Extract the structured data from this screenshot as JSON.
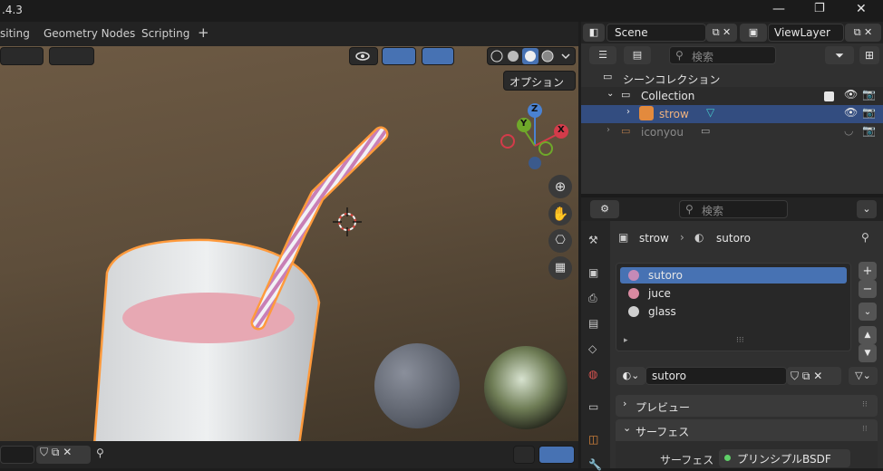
{
  "title": {
    "version": ".4.3",
    "min": "—",
    "max": "❐",
    "close": "✕"
  },
  "workspace_tabs": [
    "siting",
    "Geometry Nodes",
    "Scripting",
    "+"
  ],
  "viewport": {
    "options_label": "オプション",
    "gizmo": {
      "z": "Z",
      "y": "Y",
      "x": "X"
    }
  },
  "scene": {
    "label": "Scene",
    "viewlayer": "ViewLayer"
  },
  "outliner": {
    "search_placeholder": "検索",
    "root": "シーンコレクション",
    "collection": "Collection",
    "items": [
      {
        "name": "strow",
        "selected": true
      },
      {
        "name": "iconyou",
        "selected": false
      }
    ]
  },
  "properties": {
    "search_placeholder": "検索",
    "breadcrumb": {
      "object": "strow",
      "material": "sutoro"
    },
    "slots": [
      {
        "name": "sutoro",
        "color": "#c58ab7"
      },
      {
        "name": "juce",
        "color": "#d98aa1"
      },
      {
        "name": "glass",
        "color": "#cfcfcf"
      }
    ],
    "material_name": "sutoro",
    "panels": {
      "preview": "プレビュー",
      "surface": "サーフェス"
    },
    "surface_label": "サーフェス",
    "surface_value": "プリンシプルBSDF"
  },
  "colors": {
    "accent": "#4772b3",
    "selection": "#334d80",
    "outline": "#ff9a3c"
  }
}
